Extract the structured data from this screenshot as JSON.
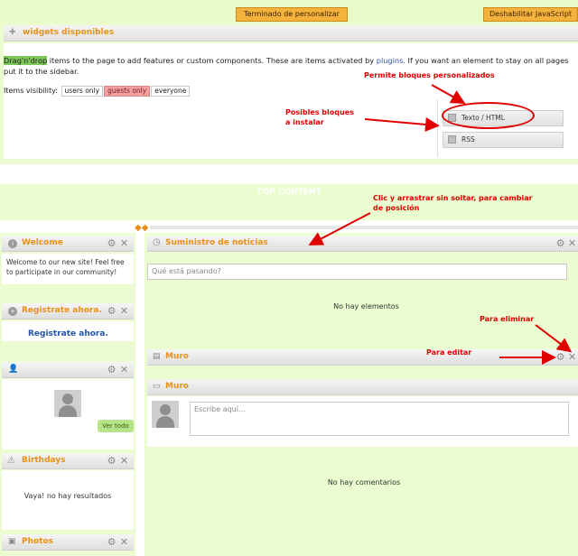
{
  "toolbar": {
    "finish_label": "Terminado de personalizar",
    "disable_js_label": "Deshabilitar JavaScript"
  },
  "widgets_panel": {
    "title": "widgets disponibles",
    "description_highlight": "Drag'n'drop",
    "description_part1": " items to the page to add features or custom components. These are items activated by ",
    "description_link": "plugins",
    "description_part2": ". If you want an element to stay on all pages put it to the sidebar.",
    "visibility_label": "Items visibility:",
    "visibility_options": [
      "users only",
      "guests only",
      "everyone"
    ],
    "available_widgets": [
      {
        "label": "Texto / HTML"
      },
      {
        "label": "RSS"
      }
    ]
  },
  "annotations": {
    "custom_blocks": "Permite bloques personalizados",
    "possible_blocks_line1": "Posibles bloques",
    "possible_blocks_line2": "a instalar",
    "drag_line1": "Clic y arrastrar sin soltar, para cambiar",
    "drag_line2": "de posición",
    "delete": "Para eliminar",
    "edit": "Para editar"
  },
  "top_content": {
    "label": "TOP CONTENT",
    "drag_handle": "◆◆"
  },
  "left_column": {
    "welcome": {
      "title": "Welcome",
      "text": "Welcome to our new site! Feel free to participate in our community!"
    },
    "register": {
      "title": "Registrate ahora.",
      "link": "Registrate ahora."
    },
    "members": {
      "see_all": "Ver todo"
    },
    "birthdays": {
      "title": "Birthdays",
      "empty": "Vaya! no hay resultados"
    },
    "photos": {
      "title": "Photos"
    }
  },
  "main_column": {
    "news_feed": {
      "title": "Suministro de noticias",
      "placeholder": "Qué está pasando?",
      "empty": "No hay elementos"
    },
    "wall_collapsed": {
      "title": "Muro"
    },
    "wall": {
      "title": "Muro",
      "placeholder": "Escribe aquí...",
      "empty": "No hay comentarios"
    }
  },
  "colors": {
    "accent_orange": "#e8901a",
    "panel_green": "#eafcd0",
    "annotation_red": "#e00000"
  }
}
